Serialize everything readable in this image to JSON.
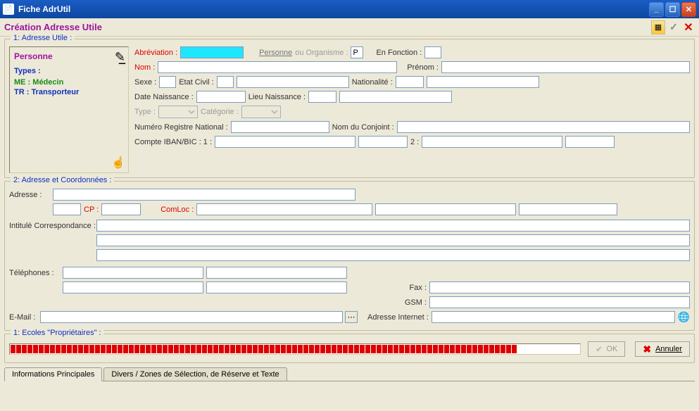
{
  "window": {
    "title": "Fiche AdrUtil"
  },
  "toolbar": {
    "title": "Création Adresse Utile"
  },
  "group1": {
    "title": "1: Adresse Utile :",
    "side": {
      "personne": "Personne",
      "types_label": "Types :",
      "type_me": "ME  : Médecin",
      "type_tr": "TR  : Transporteur"
    },
    "labels": {
      "abreviation": "Abréviation :",
      "personne": "Personne",
      "ou_organisme": " ou Organisme :",
      "en_fonction": "En Fonction :",
      "nom": "Nom :",
      "prenom": "Prénom :",
      "sexe": "Sexe :",
      "etat_civil": "Etat Civil :",
      "nationalite": "Nationalité :",
      "date_naissance": "Date Naissance :",
      "lieu_naissance": "Lieu Naissance :",
      "type": "Type :",
      "categorie": "Catégorie :",
      "nrn": "Numéro Registre National :",
      "nom_conjoint": "Nom du Conjoint :",
      "compte": "Compte IBAN/BIC : 1 :",
      "compte2": "2 :"
    },
    "values": {
      "personne_ou_organisme": "P"
    }
  },
  "group2": {
    "title": "2: Adresse et Coordonnées :",
    "labels": {
      "adresse": "Adresse :",
      "cp": "CP :",
      "comloc": "ComLoc :",
      "intitule": "Intitulé Correspondance :",
      "telephones": "Téléphones :",
      "fax": "Fax :",
      "gsm": "GSM :",
      "email": "E-Mail :",
      "adresse_internet": "Adresse Internet :"
    }
  },
  "group3": {
    "title": "1: Ecoles \"Propriétaires\" :",
    "buttons": {
      "ok": "OK",
      "annuler": "Annuler"
    }
  },
  "tabs": {
    "t1": "Informations Principales",
    "t2": "Divers / Zones de Sélection, de Réserve et Texte"
  }
}
